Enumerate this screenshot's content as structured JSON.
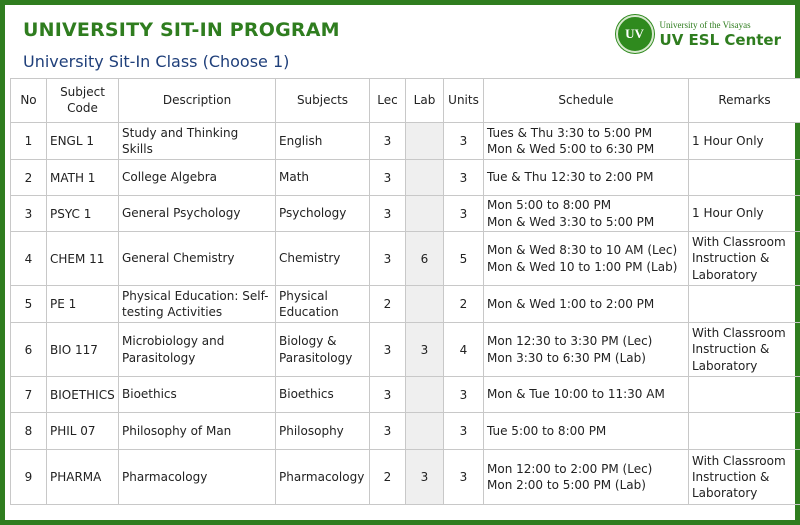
{
  "header": {
    "title": "UNIVERSITY SIT-IN PROGRAM",
    "subtitle": "University Sit-In Class (Choose 1)"
  },
  "logo": {
    "emblem_text": "UV",
    "line1": "University of the Visayas",
    "line2": "UV ESL Center"
  },
  "colors": {
    "brand_green": "#2f7d1f",
    "subtitle_blue": "#1f3f7a",
    "shaded_cell": "#efefef"
  },
  "columns": {
    "no": "No",
    "code": "Subject Code",
    "description": "Description",
    "subjects": "Subjects",
    "lec": "Lec",
    "lab": "Lab",
    "units": "Units",
    "schedule": "Schedule",
    "remarks": "Remarks"
  },
  "rows": [
    {
      "no": "1",
      "code": "ENGL 1",
      "description": "Study and Thinking Skills",
      "subjects": "English",
      "lec": "3",
      "lab": "",
      "units": "3",
      "schedule1": "Tues & Thu 3:30 to 5:00 PM",
      "schedule2": "Mon & Wed 5:00 to 6:30 PM",
      "remarks": "1 Hour Only"
    },
    {
      "no": "2",
      "code": "MATH 1",
      "description": "College Algebra",
      "subjects": "Math",
      "lec": "3",
      "lab": "",
      "units": "3",
      "schedule1": "Tue & Thu 12:30 to 2:00 PM",
      "schedule2": "",
      "remarks": ""
    },
    {
      "no": "3",
      "code": "PSYC 1",
      "description": "General Psychology",
      "subjects": "Psychology",
      "lec": "3",
      "lab": "",
      "units": "3",
      "schedule1": "Mon 5:00 to 8:00 PM",
      "schedule2": "Mon & Wed 3:30 to 5:00 PM",
      "remarks": "1 Hour Only"
    },
    {
      "no": "4",
      "code": "CHEM 11",
      "description": "General Chemistry",
      "subjects": "Chemistry",
      "lec": "3",
      "lab": "6",
      "units": "5",
      "schedule1": "Mon & Wed 8:30 to 10 AM (Lec)",
      "schedule2": "Mon & Wed 10 to 1:00 PM (Lab)",
      "remarks": "With Classroom Instruction & Laboratory"
    },
    {
      "no": "5",
      "code": "PE 1",
      "description": "Physical Education: Self-testing Activities",
      "subjects": "Physical Education",
      "lec": "2",
      "lab": "",
      "units": "2",
      "schedule1": "Mon & Wed 1:00 to 2:00 PM",
      "schedule2": "",
      "remarks": ""
    },
    {
      "no": "6",
      "code": "BIO 117",
      "description": "Microbiology and Parasitology",
      "subjects": "Biology & Parasitology",
      "lec": "3",
      "lab": "3",
      "units": "4",
      "schedule1": "Mon 12:30 to 3:30 PM (Lec)",
      "schedule2": "Mon 3:30 to 6:30 PM (Lab)",
      "remarks": "With Classroom Instruction & Laboratory"
    },
    {
      "no": "7",
      "code": "BIOETHICS",
      "description": "Bioethics",
      "subjects": "Bioethics",
      "lec": "3",
      "lab": "",
      "units": "3",
      "schedule1": "Mon & Tue 10:00 to 11:30 AM",
      "schedule2": "",
      "remarks": ""
    },
    {
      "no": "8",
      "code": "PHIL 07",
      "description": "Philosophy of Man",
      "subjects": "Philosophy",
      "lec": "3",
      "lab": "",
      "units": "3",
      "schedule1": "Tue 5:00 to 8:00 PM",
      "schedule2": "",
      "remarks": ""
    },
    {
      "no": "9",
      "code": "PHARMA",
      "description": "Pharmacology",
      "subjects": "Pharmacology",
      "lec": "2",
      "lab": "3",
      "units": "3",
      "schedule1": "Mon 12:00 to 2:00 PM (Lec)",
      "schedule2": "Mon 2:00 to 5:00 PM (Lab)",
      "remarks": "With Classroom Instruction & Laboratory"
    }
  ]
}
